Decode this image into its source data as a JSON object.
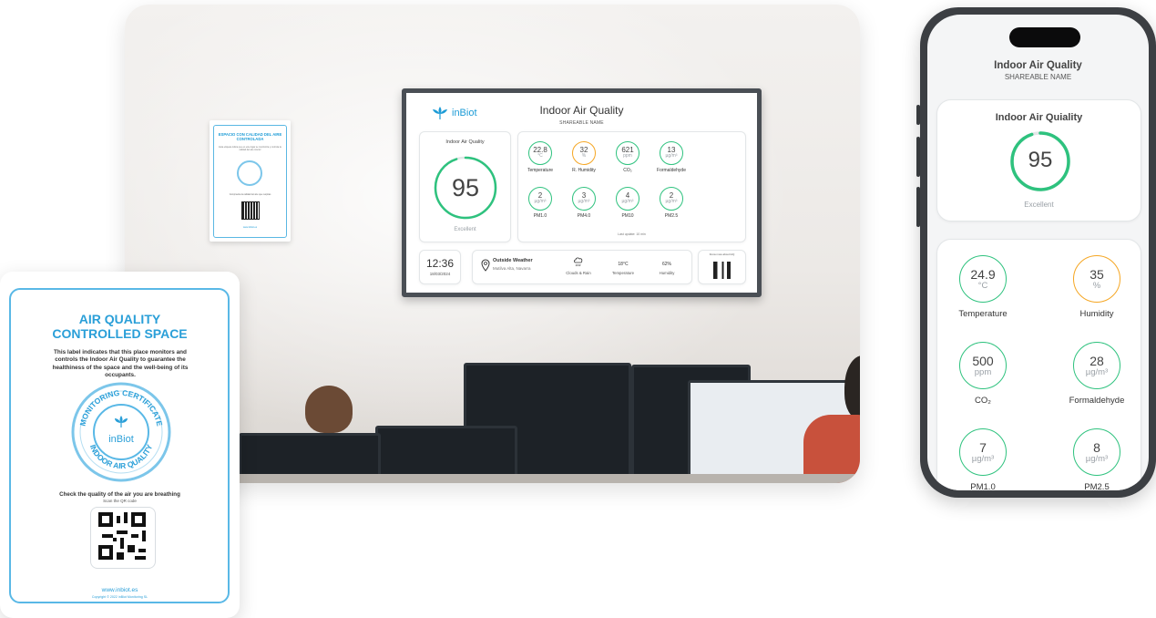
{
  "tv": {
    "brand": "inBiot",
    "title": "Indoor Air Quality",
    "subtitle": "SHAREABLE NAME",
    "iaq": {
      "label": "Indoor Air Quality",
      "score": "95",
      "status": "Excellent",
      "score_fraction": 0.95
    },
    "metrics": [
      {
        "value": "22.8",
        "unit": "°C",
        "label": "Temperature",
        "color": "green"
      },
      {
        "value": "32",
        "unit": "%",
        "label": "R. Humidity",
        "color": "orange"
      },
      {
        "value": "621",
        "unit": "ppm",
        "label": "CO₂",
        "color": "green"
      },
      {
        "value": "13",
        "unit": "µg/m³",
        "label": "Formaldehyde",
        "color": "green"
      },
      {
        "value": "2",
        "unit": "µg/m³",
        "label": "PM1.0",
        "color": "green"
      },
      {
        "value": "3",
        "unit": "µg/m³",
        "label": "PM4.0",
        "color": "green"
      },
      {
        "value": "4",
        "unit": "µg/m³",
        "label": "PM10",
        "color": "green"
      },
      {
        "value": "2",
        "unit": "µg/m³",
        "label": "PM2.5",
        "color": "green"
      }
    ],
    "last_update": "Last update: 10 min",
    "time": "12:36",
    "date": "18/03/2024",
    "weather": {
      "title": "Outside Weather",
      "location": "Mutilva Alta, Navarra",
      "condition": "Clouds & Rain",
      "temp_value": "18°C",
      "temp_label": "Temperature",
      "hum_value": "62%",
      "hum_label": "Humidity"
    },
    "qr_text": "Know more about IAQ"
  },
  "sticker": {
    "heading": "ESPACIO CON CALIDAD DEL AIRE CONTROLADA",
    "body": "Esta etiqueta indica que en este lugar se monitoriza y controla la calidad del aire interior",
    "footer": "Comprueba la calidad del aire que respiras",
    "url": "www.inbiot.es"
  },
  "certificate": {
    "title_line1": "AIR QUALITY",
    "title_line2": "CONTROLLED SPACE",
    "description": "This label indicates that this place monitors and controls the Indoor Air Quality to guarantee the healthiness of the space and the well-being of its occupants.",
    "seal_top": "MONITORING CERTIFICATE",
    "seal_brand": "inBiot",
    "seal_bottom": "INDOOR AIR QUALITY",
    "check_text": "Check the quality of the air you are breathing",
    "scan_text": "Scan the QR code",
    "url": "www.inbiot.es",
    "copyright": "Copyright © 2022 inBiot Monitoring SL"
  },
  "phone": {
    "title": "Indoor Air Quality",
    "subtitle": "SHAREABLE NAME",
    "iaq": {
      "label": "Indoor Air Quiality",
      "score": "95",
      "status": "Excellent",
      "score_fraction": 0.95
    },
    "metrics": [
      {
        "value": "24.9",
        "unit": "°C",
        "label": "Temperature",
        "color": "green"
      },
      {
        "value": "35",
        "unit": "%",
        "label": "Humidity",
        "color": "orange"
      },
      {
        "value": "500",
        "unit": "ppm",
        "label": "CO₂",
        "color": "green"
      },
      {
        "value": "28",
        "unit": "µg/m³",
        "label": "Formaldehyde",
        "color": "green"
      },
      {
        "value": "7",
        "unit": "µg/m³",
        "label": "PM1.0",
        "color": "green"
      },
      {
        "value": "8",
        "unit": "µg/m³",
        "label": "PM2.5",
        "color": "green"
      }
    ]
  },
  "colors": {
    "green": "#2ec27e",
    "orange": "#f5a623",
    "brand_blue": "#1c9bd6",
    "cert_blue": "#2a9fd8"
  }
}
